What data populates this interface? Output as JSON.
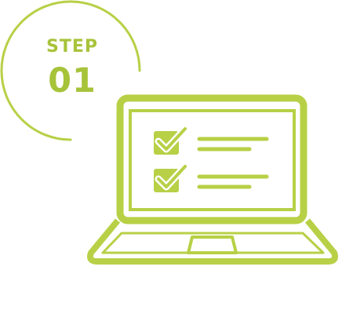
{
  "badge": {
    "step_label": "STEP",
    "step_number": "01"
  },
  "illustration": {
    "icon": "laptop-checklist-icon",
    "checklist_items": [
      {
        "checked": true
      },
      {
        "checked": true
      }
    ]
  },
  "colors": {
    "accent": "#b7d046",
    "accent_dark": "#a7c33a",
    "background": "#ffffff"
  }
}
